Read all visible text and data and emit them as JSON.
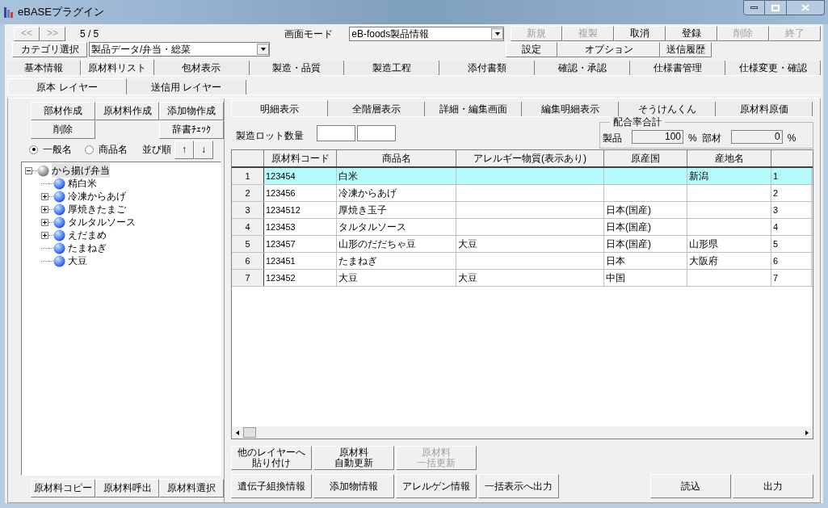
{
  "window": {
    "title": "eBASEプラグイン"
  },
  "nav": {
    "prev": "<<",
    "next": ">>",
    "position": "5 / 5"
  },
  "mode": {
    "label": "画面モード",
    "value": "eB-foods製品情報"
  },
  "actions": [
    {
      "label": "新規",
      "disabled": true
    },
    {
      "label": "複製",
      "disabled": true
    },
    {
      "label": "取消",
      "disabled": false
    },
    {
      "label": "登録",
      "disabled": false
    },
    {
      "label": "削除",
      "disabled": true
    },
    {
      "label": "終了",
      "disabled": true
    }
  ],
  "category": {
    "button": "カテゴリ選択",
    "value": "製品データ/弁当・総菜"
  },
  "actions2": [
    {
      "label": "設定"
    },
    {
      "label": "オプション"
    },
    {
      "label": "送信履歴"
    }
  ],
  "tabs": [
    {
      "label": "基本情報",
      "selected": false
    },
    {
      "label": "原材料リスト",
      "selected": true
    },
    {
      "label": "包材表示",
      "selected": false
    },
    {
      "label": "製造・品質",
      "selected": false
    },
    {
      "label": "製造工程",
      "selected": false
    },
    {
      "label": "添付書類",
      "selected": false
    },
    {
      "label": "確認・承認",
      "selected": false
    },
    {
      "label": "仕様書管理",
      "selected": false
    },
    {
      "label": "仕様変更・確認",
      "selected": false
    }
  ],
  "layer_tabs": [
    {
      "label": "原本 レイヤー",
      "selected": true
    },
    {
      "label": "送信用 レイヤー",
      "selected": false
    }
  ],
  "left": {
    "buttons_row1": [
      "部材作成",
      "原材料作成",
      "添加物作成"
    ],
    "delete_button": "削除",
    "dict_button": "辞書ﾁｪｯｸ",
    "name_options": [
      {
        "label": "一般名",
        "selected": true
      },
      {
        "label": "商品名",
        "selected": false
      }
    ],
    "sort": {
      "label": "並び順",
      "up": "↑",
      "down": "↓"
    },
    "tree": {
      "label": "から揚げ弁当",
      "expanded": true,
      "selected": true,
      "children": [
        {
          "label": "精白米",
          "expandable": false,
          "selected": false
        },
        {
          "label": "冷凍からあげ",
          "expandable": true,
          "selected": false
        },
        {
          "label": "厚焼きたまご",
          "expandable": true,
          "selected": false
        },
        {
          "label": "タルタルソース",
          "expandable": true,
          "selected": false
        },
        {
          "label": "えだまめ",
          "expandable": true,
          "selected": false
        },
        {
          "label": "たまねぎ",
          "expandable": false,
          "selected": false
        },
        {
          "label": "大豆",
          "expandable": false,
          "selected": false
        }
      ]
    },
    "bottom_buttons": [
      "原材料コピー",
      "原材料呼出",
      "原材料選択"
    ]
  },
  "detail_tabs": [
    {
      "label": "明細表示",
      "selected": true
    },
    {
      "label": "全階層表示",
      "selected": false
    },
    {
      "label": "詳細・編集画面",
      "selected": false
    },
    {
      "label": "編集明細表示",
      "selected": false
    },
    {
      "label": "そうけんくん",
      "selected": false
    },
    {
      "label": "原材料原価",
      "selected": false
    }
  ],
  "lot": {
    "label": "製造ロット数量"
  },
  "ratio": {
    "title": "配合率合計",
    "product_label": "製品",
    "product_value": "100",
    "product_unit": "%",
    "part_label": "部材",
    "part_value": "0",
    "part_unit": "%"
  },
  "table": {
    "columns": [
      "原材料コード",
      "商品名",
      "アレルギー物質(表示あり)",
      "原産国",
      "産地名"
    ],
    "rows": [
      {
        "number": "1",
        "selected": true,
        "cells": [
          "123454",
          "白米",
          "",
          "",
          "新潟",
          "1"
        ]
      },
      {
        "number": "2",
        "selected": false,
        "cells": [
          "123456",
          "冷凍からあげ",
          "",
          "",
          "",
          "2"
        ]
      },
      {
        "number": "3",
        "selected": false,
        "cells": [
          "1234512",
          "厚焼き玉子",
          "",
          "日本(国産)",
          "",
          "3"
        ]
      },
      {
        "number": "4",
        "selected": false,
        "cells": [
          "123453",
          "タルタルソース",
          "",
          "日本(国産)",
          "",
          "4"
        ]
      },
      {
        "number": "5",
        "selected": false,
        "cells": [
          "123457",
          "山形のだだちゃ豆",
          "大豆",
          "日本(国産)",
          "山形県",
          "5"
        ]
      },
      {
        "number": "6",
        "selected": false,
        "cells": [
          "123451",
          "たまねぎ",
          "",
          "日本",
          "大阪府",
          "6"
        ]
      },
      {
        "number": "7",
        "selected": false,
        "cells": [
          "123452",
          "大豆",
          "大豆",
          "中国",
          "",
          "7"
        ]
      }
    ]
  },
  "buttons_row1": [
    {
      "lines": [
        "他のレイヤーへ",
        "貼り付け"
      ],
      "disabled": false
    },
    {
      "lines": [
        "原材料",
        "自動更新"
      ],
      "disabled": false
    },
    {
      "lines": [
        "原材料",
        "一括更新"
      ],
      "disabled": true
    }
  ],
  "buttons_row2": [
    "遺伝子組換情報",
    "添加物情報",
    "アレルゲン情報",
    "一括表示へ出力"
  ],
  "buttons_right": [
    "読込",
    "出力"
  ]
}
